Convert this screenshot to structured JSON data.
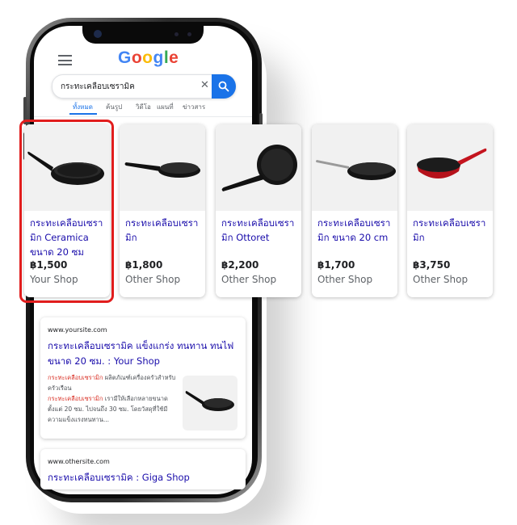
{
  "search": {
    "logo": [
      "G",
      "o",
      "o",
      "g",
      "l",
      "e"
    ],
    "query": "กระทะเคลือบเซรามิค",
    "tabs": [
      "ทั้งหมด",
      "ค้นรูป",
      "วิดีโอ",
      "แผนที่",
      "ข่าวสาร"
    ],
    "active_tab": "ทั้งหมด"
  },
  "products": [
    {
      "title": "กระทะเคลือบเซรามิก Ceramica ขนาด 20 ซม",
      "price": "฿1,500",
      "shop": "Your Shop",
      "icon": "black-frying-pan-icon",
      "highlighted": true
    },
    {
      "title": "กระทะเคลือบเซรามิก",
      "price": "฿1,800",
      "shop": "Other Shop",
      "icon": "shallow-frying-pan-icon"
    },
    {
      "title": "กระทะเคลือบเซรามิก Ottoret",
      "price": "฿2,200",
      "shop": "Other Shop",
      "icon": "deep-frying-pan-icon"
    },
    {
      "title": "กระทะเคลือบเซรามิก ขนาด 20 cm",
      "price": "฿1,700",
      "shop": "Other Shop",
      "icon": "steel-handle-pan-icon"
    },
    {
      "title": "กระทะเคลือบเซรามิก",
      "price": "฿3,750",
      "shop": "Other Shop",
      "icon": "red-wok-icon"
    }
  ],
  "results": [
    {
      "site": "www.yoursite.com",
      "title": "กระทะเคลือบเซรามิค แข็งแกร่ง ทนทาน ทนไฟ ขนาด 20 ซม. : Your Shop",
      "snippet": [
        {
          "hl": "กระทะเคลือบเซรามิก",
          "text": " ผลิตภัณฑ์เครื่องครัวสำหรับครัวเรือน"
        },
        {
          "hl": "กระทะเคลือบเซรามิก",
          "text": " เรามีให้เลือกหลายขนาด ตั้งแต่ 20 ซม. ไปจนถึง 30 ซม. โดยวัสดุที่ใช้มีความแข็งแรงทนทาน..."
        }
      ]
    },
    {
      "site": "www.othersite.com",
      "title": "กระทะเคลือบเซรามิค : Giga Shop"
    }
  ],
  "colors": {
    "link": "#1a0dab",
    "accent": "#1a73e8",
    "highlight_border": "#e11d1d",
    "snippet_highlight": "#d93025",
    "google_blue": "#4285F4",
    "google_red": "#EA4335",
    "google_yellow": "#FBBC05",
    "google_green": "#34A853"
  }
}
